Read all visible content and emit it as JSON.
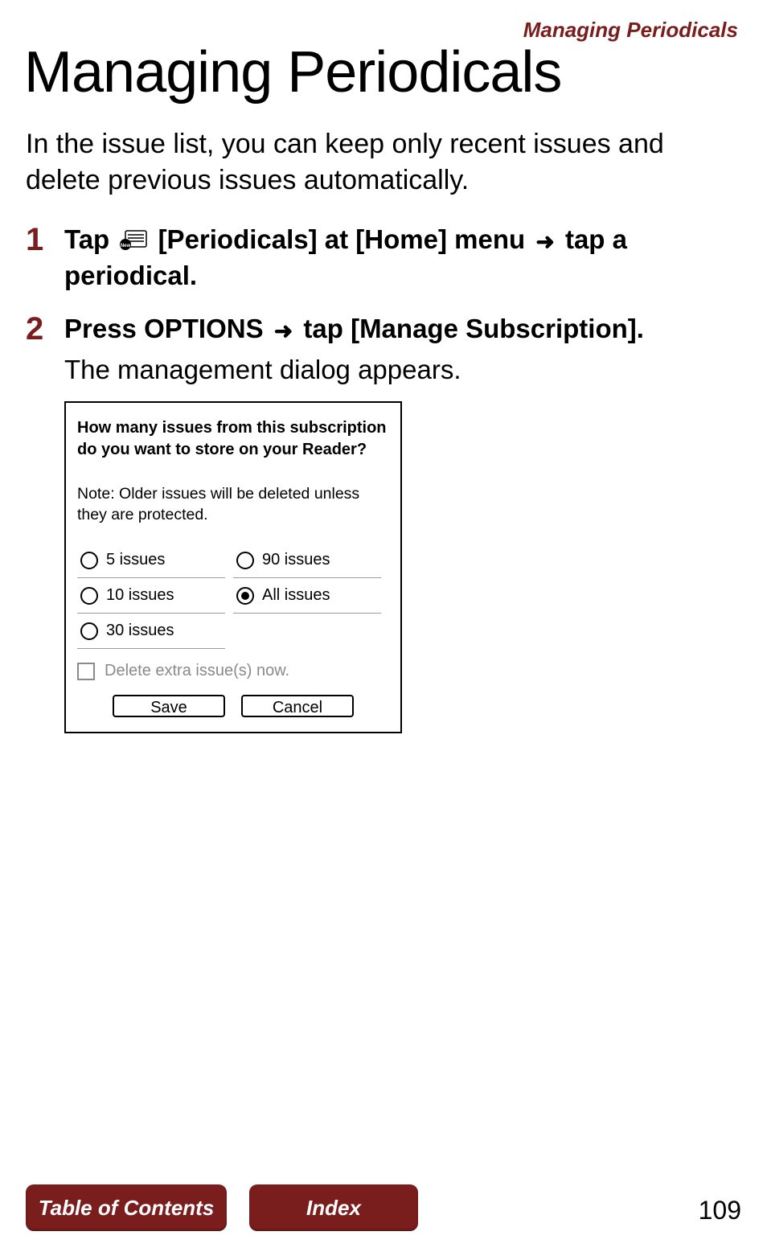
{
  "header": {
    "section_label": "Managing Periodicals"
  },
  "title": "Managing Periodicals",
  "intro": "In the issue list, you can keep only recent issues and delete previous issues automatically.",
  "steps": [
    {
      "num": "1",
      "bold_pre": "Tap ",
      "bold_mid1": " [Periodicals] at [Home] menu ",
      "bold_mid2": " tap a periodical."
    },
    {
      "num": "2",
      "bold_pre": "Press OPTIONS ",
      "bold_mid1": " tap [Manage Subscription].",
      "text": "The management dialog appears."
    }
  ],
  "dialog": {
    "question": "How many issues from this subscription do you want to store on your Reader?",
    "note": "Note: Older issues will be deleted unless they are protected.",
    "options": [
      {
        "label": "5 issues",
        "selected": false
      },
      {
        "label": "90 issues",
        "selected": false
      },
      {
        "label": "10 issues",
        "selected": false
      },
      {
        "label": "All issues",
        "selected": true
      },
      {
        "label": "30 issues",
        "selected": false
      }
    ],
    "checkbox_label": "Delete extra issue(s) now.",
    "checkbox_checked": false,
    "save_label": "Save",
    "cancel_label": "Cancel"
  },
  "footer": {
    "toc_label": "Table of Contents",
    "index_label": "Index",
    "page_number": "109"
  }
}
